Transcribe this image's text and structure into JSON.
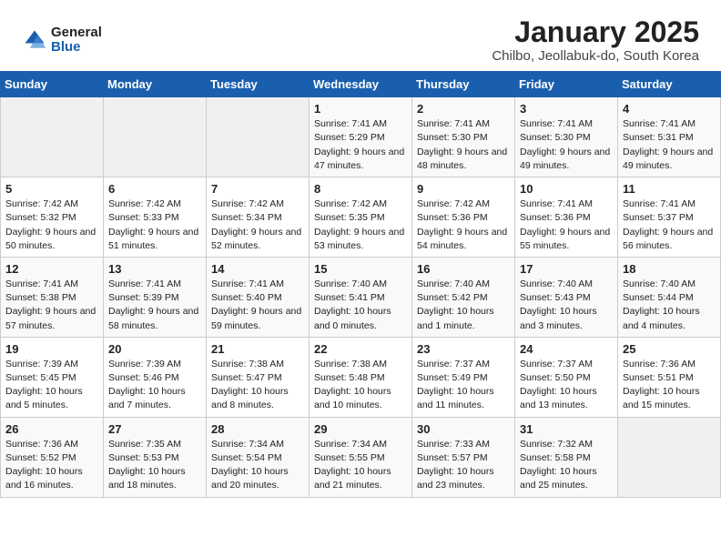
{
  "header": {
    "logo_general": "General",
    "logo_blue": "Blue",
    "month_title": "January 2025",
    "location": "Chilbo, Jeollabuk-do, South Korea"
  },
  "weekdays": [
    "Sunday",
    "Monday",
    "Tuesday",
    "Wednesday",
    "Thursday",
    "Friday",
    "Saturday"
  ],
  "weeks": [
    [
      {
        "day": "",
        "info": ""
      },
      {
        "day": "",
        "info": ""
      },
      {
        "day": "",
        "info": ""
      },
      {
        "day": "1",
        "info": "Sunrise: 7:41 AM\nSunset: 5:29 PM\nDaylight: 9 hours\nand 47 minutes."
      },
      {
        "day": "2",
        "info": "Sunrise: 7:41 AM\nSunset: 5:30 PM\nDaylight: 9 hours\nand 48 minutes."
      },
      {
        "day": "3",
        "info": "Sunrise: 7:41 AM\nSunset: 5:30 PM\nDaylight: 9 hours\nand 49 minutes."
      },
      {
        "day": "4",
        "info": "Sunrise: 7:41 AM\nSunset: 5:31 PM\nDaylight: 9 hours\nand 49 minutes."
      }
    ],
    [
      {
        "day": "5",
        "info": "Sunrise: 7:42 AM\nSunset: 5:32 PM\nDaylight: 9 hours\nand 50 minutes."
      },
      {
        "day": "6",
        "info": "Sunrise: 7:42 AM\nSunset: 5:33 PM\nDaylight: 9 hours\nand 51 minutes."
      },
      {
        "day": "7",
        "info": "Sunrise: 7:42 AM\nSunset: 5:34 PM\nDaylight: 9 hours\nand 52 minutes."
      },
      {
        "day": "8",
        "info": "Sunrise: 7:42 AM\nSunset: 5:35 PM\nDaylight: 9 hours\nand 53 minutes."
      },
      {
        "day": "9",
        "info": "Sunrise: 7:42 AM\nSunset: 5:36 PM\nDaylight: 9 hours\nand 54 minutes."
      },
      {
        "day": "10",
        "info": "Sunrise: 7:41 AM\nSunset: 5:36 PM\nDaylight: 9 hours\nand 55 minutes."
      },
      {
        "day": "11",
        "info": "Sunrise: 7:41 AM\nSunset: 5:37 PM\nDaylight: 9 hours\nand 56 minutes."
      }
    ],
    [
      {
        "day": "12",
        "info": "Sunrise: 7:41 AM\nSunset: 5:38 PM\nDaylight: 9 hours\nand 57 minutes."
      },
      {
        "day": "13",
        "info": "Sunrise: 7:41 AM\nSunset: 5:39 PM\nDaylight: 9 hours\nand 58 minutes."
      },
      {
        "day": "14",
        "info": "Sunrise: 7:41 AM\nSunset: 5:40 PM\nDaylight: 9 hours\nand 59 minutes."
      },
      {
        "day": "15",
        "info": "Sunrise: 7:40 AM\nSunset: 5:41 PM\nDaylight: 10 hours\nand 0 minutes."
      },
      {
        "day": "16",
        "info": "Sunrise: 7:40 AM\nSunset: 5:42 PM\nDaylight: 10 hours\nand 1 minute."
      },
      {
        "day": "17",
        "info": "Sunrise: 7:40 AM\nSunset: 5:43 PM\nDaylight: 10 hours\nand 3 minutes."
      },
      {
        "day": "18",
        "info": "Sunrise: 7:40 AM\nSunset: 5:44 PM\nDaylight: 10 hours\nand 4 minutes."
      }
    ],
    [
      {
        "day": "19",
        "info": "Sunrise: 7:39 AM\nSunset: 5:45 PM\nDaylight: 10 hours\nand 5 minutes."
      },
      {
        "day": "20",
        "info": "Sunrise: 7:39 AM\nSunset: 5:46 PM\nDaylight: 10 hours\nand 7 minutes."
      },
      {
        "day": "21",
        "info": "Sunrise: 7:38 AM\nSunset: 5:47 PM\nDaylight: 10 hours\nand 8 minutes."
      },
      {
        "day": "22",
        "info": "Sunrise: 7:38 AM\nSunset: 5:48 PM\nDaylight: 10 hours\nand 10 minutes."
      },
      {
        "day": "23",
        "info": "Sunrise: 7:37 AM\nSunset: 5:49 PM\nDaylight: 10 hours\nand 11 minutes."
      },
      {
        "day": "24",
        "info": "Sunrise: 7:37 AM\nSunset: 5:50 PM\nDaylight: 10 hours\nand 13 minutes."
      },
      {
        "day": "25",
        "info": "Sunrise: 7:36 AM\nSunset: 5:51 PM\nDaylight: 10 hours\nand 15 minutes."
      }
    ],
    [
      {
        "day": "26",
        "info": "Sunrise: 7:36 AM\nSunset: 5:52 PM\nDaylight: 10 hours\nand 16 minutes."
      },
      {
        "day": "27",
        "info": "Sunrise: 7:35 AM\nSunset: 5:53 PM\nDaylight: 10 hours\nand 18 minutes."
      },
      {
        "day": "28",
        "info": "Sunrise: 7:34 AM\nSunset: 5:54 PM\nDaylight: 10 hours\nand 20 minutes."
      },
      {
        "day": "29",
        "info": "Sunrise: 7:34 AM\nSunset: 5:55 PM\nDaylight: 10 hours\nand 21 minutes."
      },
      {
        "day": "30",
        "info": "Sunrise: 7:33 AM\nSunset: 5:57 PM\nDaylight: 10 hours\nand 23 minutes."
      },
      {
        "day": "31",
        "info": "Sunrise: 7:32 AM\nSunset: 5:58 PM\nDaylight: 10 hours\nand 25 minutes."
      },
      {
        "day": "",
        "info": ""
      }
    ]
  ]
}
